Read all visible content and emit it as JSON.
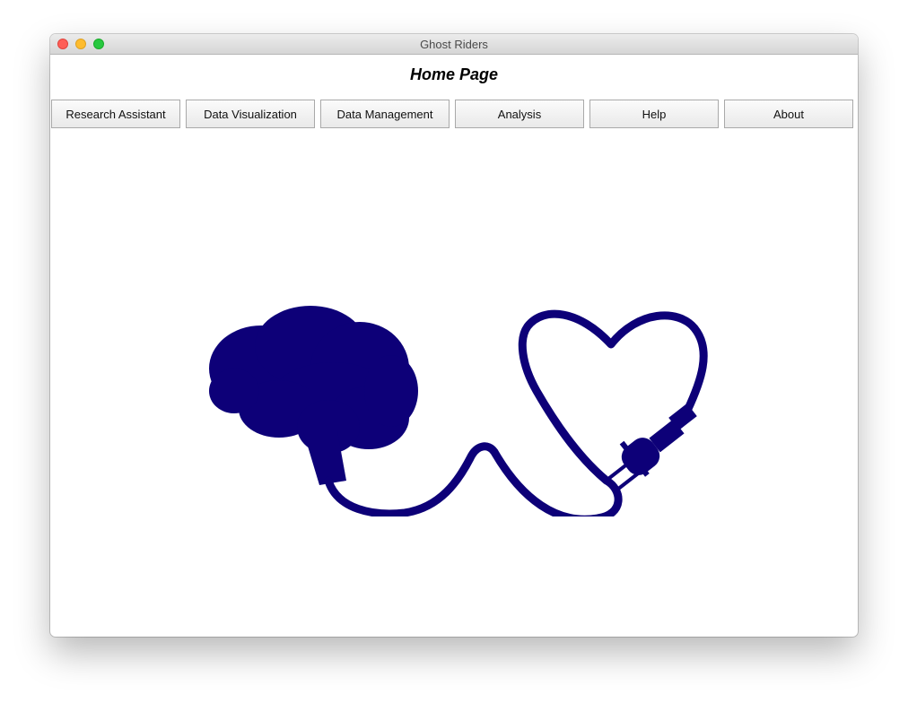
{
  "window": {
    "title": "Ghost Riders"
  },
  "page": {
    "title": "Home Page"
  },
  "nav": {
    "buttons": [
      {
        "label": "Research Assistant"
      },
      {
        "label": "Data Visualization"
      },
      {
        "label": "Data Management"
      },
      {
        "label": "Analysis"
      },
      {
        "label": "Help"
      },
      {
        "label": "About"
      }
    ]
  },
  "colors": {
    "illustration": "#0d0078",
    "close": "#fe5f57",
    "minimize": "#febc2e",
    "zoom": "#28c840"
  },
  "illustration": {
    "icon": "brain-heart-plug-icon"
  }
}
